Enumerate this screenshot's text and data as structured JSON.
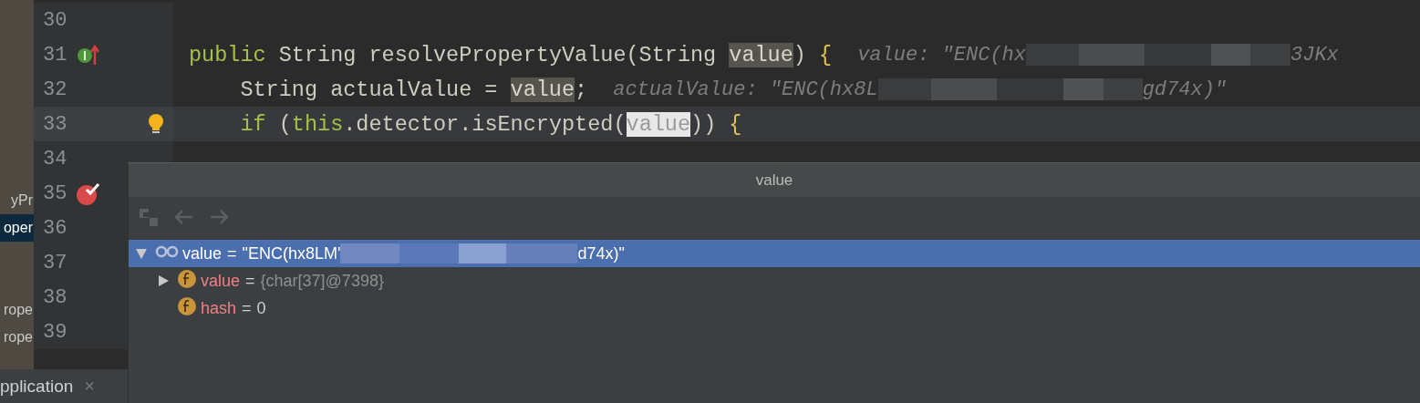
{
  "project_panel": {
    "items": [
      {
        "label": "yPr",
        "selected": false
      },
      {
        "label": "oper",
        "selected": true
      },
      {
        "label": "rope",
        "selected": false
      },
      {
        "label": "rope",
        "selected": false
      }
    ]
  },
  "bottom_tab": {
    "label": "pplication",
    "close": "×"
  },
  "editor": {
    "lines": [
      {
        "number": "30",
        "current": false
      },
      {
        "number": "31",
        "current": false,
        "markers": [
          {
            "kind": "implements"
          }
        ],
        "tokens": [
          {
            "kind": "keyword",
            "text": "public"
          },
          {
            "kind": "plain",
            "text": " String resolvePropertyValue(String "
          },
          {
            "kind": "usage",
            "text": "value"
          },
          {
            "kind": "plain",
            "text": ") "
          },
          {
            "kind": "brace",
            "text": "{"
          },
          {
            "kind": "hint",
            "text": "value: \"ENC(hx"
          },
          {
            "kind": "redacted"
          },
          {
            "kind": "hint",
            "text": "3JKx"
          }
        ]
      },
      {
        "number": "32",
        "current": false,
        "tokens": [
          {
            "kind": "plain",
            "text": "    String actualValue = "
          },
          {
            "kind": "usage",
            "text": "value"
          },
          {
            "kind": "plain",
            "text": ";"
          },
          {
            "kind": "hint",
            "text": "actualValue: \"ENC(hx8L"
          },
          {
            "kind": "redacted"
          },
          {
            "kind": "hint",
            "text": "gd74x)\""
          }
        ]
      },
      {
        "number": "33",
        "current": true,
        "markers": [
          {
            "kind": "intention"
          }
        ],
        "tokens": [
          {
            "kind": "keyword",
            "text": "    if"
          },
          {
            "kind": "plain",
            "text": " ("
          },
          {
            "kind": "keyword",
            "text": "this"
          },
          {
            "kind": "plain",
            "text": ".detector.isEncrypted("
          },
          {
            "kind": "usage_write",
            "text": "value"
          },
          {
            "kind": "plain",
            "text": ")) "
          },
          {
            "kind": "brace",
            "text": "{"
          }
        ]
      },
      {
        "number": "34",
        "current": false
      },
      {
        "number": "35",
        "current": false,
        "markers": [
          {
            "kind": "breakpoint"
          }
        ]
      },
      {
        "number": "36",
        "current": false
      },
      {
        "number": "37",
        "current": false
      },
      {
        "number": "38",
        "current": false
      },
      {
        "number": "39",
        "current": false
      }
    ]
  },
  "popup": {
    "title": "value",
    "toolbar": [
      {
        "kind": "group",
        "disabled": true
      },
      {
        "kind": "back",
        "disabled": true
      },
      {
        "kind": "forward",
        "disabled": true
      }
    ],
    "tree": [
      {
        "kind": "watch",
        "selected": true,
        "expanded": true,
        "name": "value",
        "sep": "=",
        "value": "\"ENC(hx8LM'",
        "redacted": true,
        "value_end": "d74x)\"",
        "children": [
          {
            "kind": "field",
            "selected": false,
            "expanded": false,
            "name": "value",
            "sep": "=",
            "value": "{char[37]@7398}"
          },
          {
            "kind": "field",
            "selected": false,
            "name": "hash",
            "sep": "=",
            "value": "0"
          }
        ]
      }
    ]
  }
}
